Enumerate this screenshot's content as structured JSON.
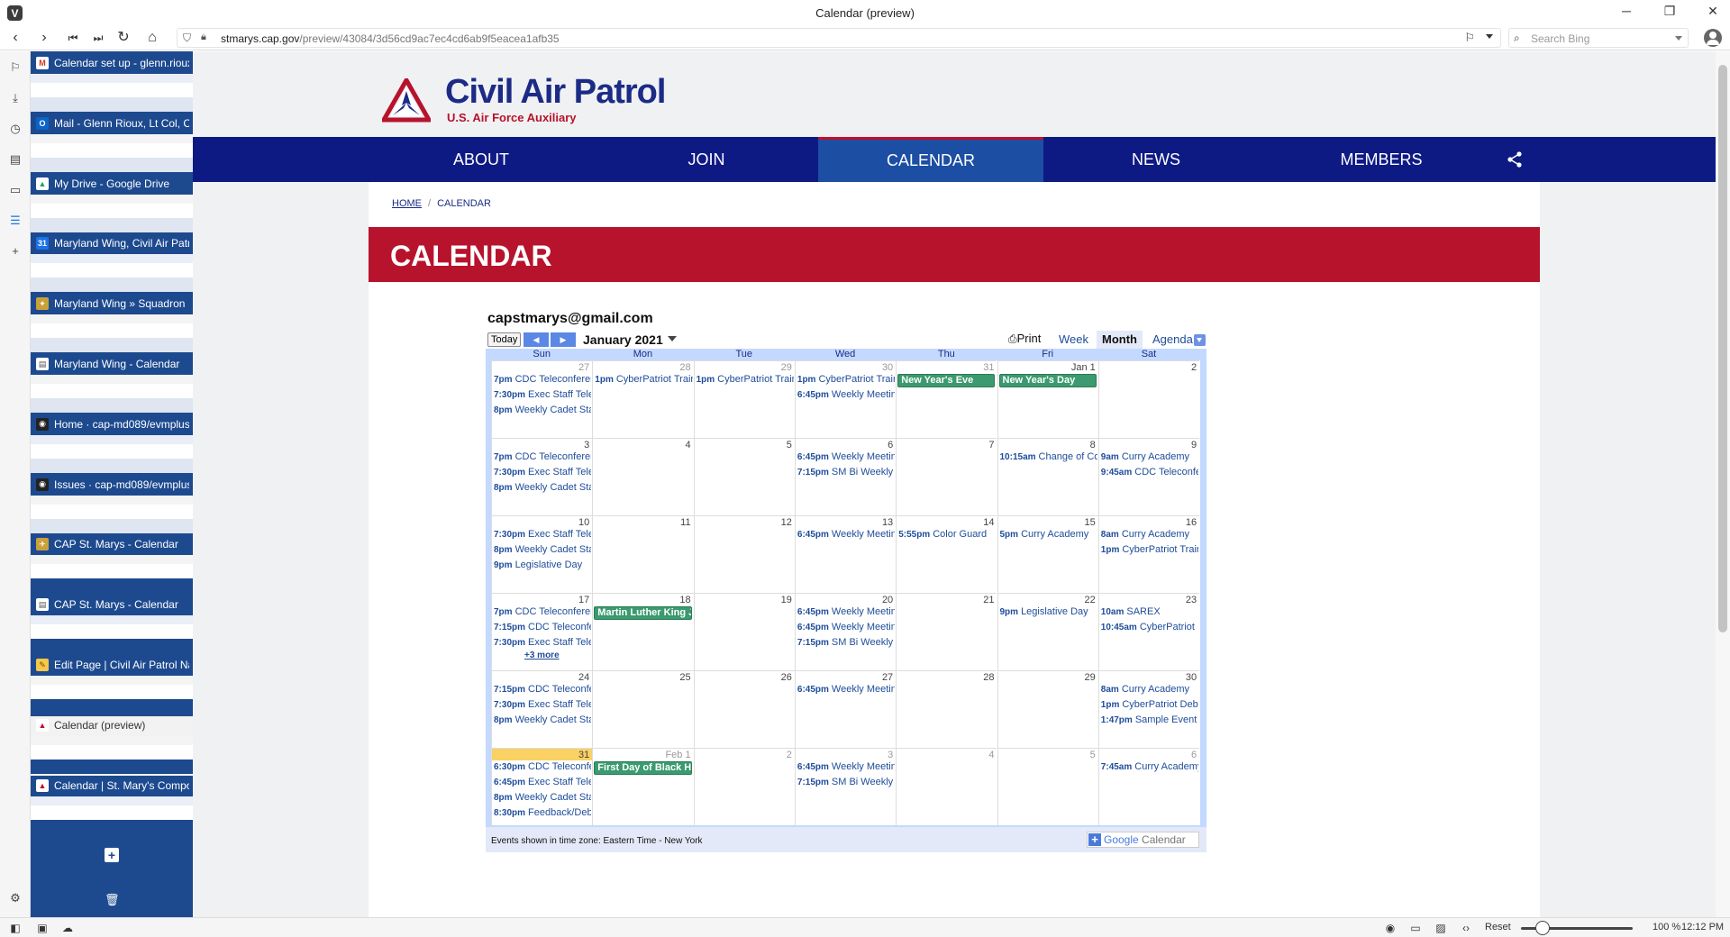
{
  "window": {
    "title": "Calendar (preview)",
    "minimize": "─",
    "restore": "❐",
    "close": "✕"
  },
  "toolbar": {
    "url_host": "stmarys.cap.gov",
    "url_path": "/preview/43084/3d56cd9ac7ec4cd6ab9f5eacea1afb35",
    "search_placeholder": "Search Bing"
  },
  "tabs": [
    {
      "title": "Calendar set up - glenn.rioux",
      "icon_color": "#ffffff",
      "icon_char": "M",
      "icon_fg": "#d93025"
    },
    {
      "title": "Mail - Glenn Rioux, Lt Col, CAP",
      "icon_color": "#0a64c9",
      "icon_char": "O",
      "icon_fg": "#ffffff"
    },
    {
      "title": "My Drive - Google Drive",
      "icon_color": "#ffffff",
      "icon_char": "▲",
      "icon_fg": "#1da462"
    },
    {
      "title": "Maryland Wing, Civil Air Patrol",
      "icon_color": "#1a73e8",
      "icon_char": "31",
      "icon_fg": "#ffffff"
    },
    {
      "title": "Maryland Wing » Squadron",
      "icon_color": "#c9a13a",
      "icon_char": "✦",
      "icon_fg": "#ffffff"
    },
    {
      "title": "Maryland Wing - Calendar",
      "icon_color": "#ffffff",
      "icon_char": "▤",
      "icon_fg": "#555555"
    },
    {
      "title": "Home · cap-md089/evmplus",
      "icon_color": "#222222",
      "icon_char": "◉",
      "icon_fg": "#ffffff"
    },
    {
      "title": "Issues · cap-md089/evmplus",
      "icon_color": "#222222",
      "icon_char": "◉",
      "icon_fg": "#ffffff"
    },
    {
      "title": "CAP St. Marys - Calendar",
      "icon_color": "#c9a13a",
      "icon_char": "✈",
      "icon_fg": "#ffffff"
    },
    {
      "title": "CAP St. Marys - Calendar",
      "icon_color": "#ffffff",
      "icon_char": "▤",
      "icon_fg": "#555555"
    },
    {
      "title": "Edit Page | Civil Air Patrol National",
      "icon_color": "#f4c84a",
      "icon_char": "✎",
      "icon_fg": "#7a4a00"
    },
    {
      "title": "Calendar (preview)",
      "icon_color": "#ffffff",
      "icon_char": "▲",
      "icon_fg": "#c0102a",
      "active": true
    },
    {
      "title": "Calendar | St. Mary's Composite",
      "icon_color": "#ffffff",
      "icon_char": "▲",
      "icon_fg": "#c0102a"
    }
  ],
  "site": {
    "name": "Civil Air Patrol",
    "subtitle": "U.S. Air Force Auxiliary",
    "nav": [
      "ABOUT",
      "JOIN",
      "CALENDAR",
      "NEWS",
      "MEMBERS"
    ],
    "active_nav": "CALENDAR",
    "breadcrumb_home": "HOME",
    "breadcrumb_current": "CALENDAR",
    "page_heading": "CALENDAR"
  },
  "calendar": {
    "owner": "capstmarys@gmail.com",
    "today_label": "Today",
    "prev": "◀",
    "next": "▶",
    "month_label": "January 2021",
    "print_label": "Print",
    "views": [
      "Week",
      "Month",
      "Agenda"
    ],
    "active_view": "Month",
    "days_of_week": [
      "Sun",
      "Mon",
      "Tue",
      "Wed",
      "Thu",
      "Fri",
      "Sat"
    ],
    "timezone_note": "Events shown in time zone: Eastern Time - New York",
    "gcal_brand": "Google",
    "gcal_label": "Calendar",
    "weeks": [
      [
        {
          "day": "27",
          "other": true,
          "events": [
            {
              "t": "7pm",
              "n": "CDC Teleconference"
            },
            {
              "t": "7:30pm",
              "n": "Exec Staff Teleconference"
            },
            {
              "t": "8pm",
              "n": "Weekly Cadet Staff"
            }
          ]
        },
        {
          "day": "28",
          "other": true,
          "events": [
            {
              "t": "1pm",
              "n": "CyberPatriot Training"
            }
          ]
        },
        {
          "day": "29",
          "other": true,
          "events": [
            {
              "t": "1pm",
              "n": "CyberPatriot Training"
            }
          ]
        },
        {
          "day": "30",
          "other": true,
          "events": [
            {
              "t": "1pm",
              "n": "CyberPatriot Training"
            },
            {
              "t": "6:45pm",
              "n": "Weekly Meeting"
            }
          ]
        },
        {
          "day": "31",
          "other": true,
          "allday": "New Year's Eve",
          "events": []
        },
        {
          "day": "Jan 1",
          "other": false,
          "allday": "New Year's Day",
          "events": []
        },
        {
          "day": "2",
          "other": false,
          "events": []
        }
      ],
      [
        {
          "day": "3",
          "events": [
            {
              "t": "7pm",
              "n": "CDC Teleconference"
            },
            {
              "t": "7:30pm",
              "n": "Exec Staff Teleconference"
            },
            {
              "t": "8pm",
              "n": "Weekly Cadet Staff"
            }
          ]
        },
        {
          "day": "4",
          "events": []
        },
        {
          "day": "5",
          "events": []
        },
        {
          "day": "6",
          "events": [
            {
              "t": "6:45pm",
              "n": "Weekly Meeting"
            },
            {
              "t": "7:15pm",
              "n": "SM Bi Weekly"
            }
          ]
        },
        {
          "day": "7",
          "events": []
        },
        {
          "day": "8",
          "events": [
            {
              "t": "10:15am",
              "n": "Change of Command"
            }
          ]
        },
        {
          "day": "9",
          "events": [
            {
              "t": "9am",
              "n": "Curry Academy"
            },
            {
              "t": "9:45am",
              "n": "CDC Teleconference"
            }
          ]
        }
      ],
      [
        {
          "day": "10",
          "events": [
            {
              "t": "7:30pm",
              "n": "Exec Staff Teleconference"
            },
            {
              "t": "8pm",
              "n": "Weekly Cadet Staff"
            },
            {
              "t": "9pm",
              "n": "Legislative Day"
            }
          ]
        },
        {
          "day": "11",
          "events": []
        },
        {
          "day": "12",
          "events": []
        },
        {
          "day": "13",
          "events": [
            {
              "t": "6:45pm",
              "n": "Weekly Meeting"
            }
          ]
        },
        {
          "day": "14",
          "events": [
            {
              "t": "5:55pm",
              "n": "Color Guard"
            }
          ]
        },
        {
          "day": "15",
          "events": [
            {
              "t": "5pm",
              "n": "Curry Academy"
            }
          ]
        },
        {
          "day": "16",
          "events": [
            {
              "t": "8am",
              "n": "Curry Academy"
            },
            {
              "t": "1pm",
              "n": "CyberPatriot Training"
            }
          ]
        }
      ],
      [
        {
          "day": "17",
          "events": [
            {
              "t": "7pm",
              "n": "CDC Teleconference"
            },
            {
              "t": "7:15pm",
              "n": "CDC Teleconference"
            },
            {
              "t": "7:30pm",
              "n": "Exec Staff Teleconference"
            }
          ],
          "more": "+3 more"
        },
        {
          "day": "18",
          "allday": "Martin Luther King Jr. Day",
          "events": []
        },
        {
          "day": "19",
          "events": []
        },
        {
          "day": "20",
          "events": [
            {
              "t": "6:45pm",
              "n": "Weekly Meeting"
            },
            {
              "t": "6:45pm",
              "n": "Weekly Meeting"
            },
            {
              "t": "7:15pm",
              "n": "SM Bi Weekly"
            }
          ]
        },
        {
          "day": "21",
          "events": []
        },
        {
          "day": "22",
          "events": [
            {
              "t": "9pm",
              "n": "Legislative Day"
            }
          ]
        },
        {
          "day": "23",
          "events": [
            {
              "t": "10am",
              "n": "SAREX"
            },
            {
              "t": "10:45am",
              "n": "CyberPatriot"
            }
          ]
        }
      ],
      [
        {
          "day": "24",
          "events": [
            {
              "t": "7:15pm",
              "n": "CDC Teleconference"
            },
            {
              "t": "7:30pm",
              "n": "Exec Staff Teleconference"
            },
            {
              "t": "8pm",
              "n": "Weekly Cadet Staff"
            }
          ]
        },
        {
          "day": "25",
          "events": []
        },
        {
          "day": "26",
          "events": []
        },
        {
          "day": "27",
          "events": [
            {
              "t": "6:45pm",
              "n": "Weekly Meeting"
            }
          ]
        },
        {
          "day": "28",
          "events": []
        },
        {
          "day": "29",
          "events": []
        },
        {
          "day": "30",
          "events": [
            {
              "t": "8am",
              "n": "Curry Academy"
            },
            {
              "t": "1pm",
              "n": "CyberPatriot Debrief"
            },
            {
              "t": "1:47pm",
              "n": "Sample Event"
            }
          ]
        }
      ],
      [
        {
          "day": "31",
          "today": true,
          "events": [
            {
              "t": "6:30pm",
              "n": "CDC Teleconference"
            },
            {
              "t": "6:45pm",
              "n": "Exec Staff Teleconference"
            },
            {
              "t": "8pm",
              "n": "Weekly Cadet Staff"
            },
            {
              "t": "8:30pm",
              "n": "Feedback/Debrief"
            }
          ]
        },
        {
          "day": "Feb 1",
          "other": true,
          "allday": "First Day of Black History Month",
          "events": []
        },
        {
          "day": "2",
          "other": true,
          "events": []
        },
        {
          "day": "3",
          "other": true,
          "events": [
            {
              "t": "6:45pm",
              "n": "Weekly Meeting"
            },
            {
              "t": "7:15pm",
              "n": "SM Bi Weekly"
            }
          ]
        },
        {
          "day": "4",
          "other": true,
          "events": []
        },
        {
          "day": "5",
          "other": true,
          "events": []
        },
        {
          "day": "6",
          "other": true,
          "events": [
            {
              "t": "7:45am",
              "n": "Curry Academy"
            }
          ]
        }
      ]
    ]
  },
  "status": {
    "reset": "Reset",
    "zoom": "100 %",
    "clock": "12:12 PM"
  },
  "colors": {
    "nav_bg": "#0e1a84",
    "nav_active": "#1c4ea3",
    "heading_red": "#b7132c",
    "brand_blue": "#1b2b86",
    "tab_panel": "#1d4a8f",
    "allday_green": "#3b9a6f",
    "today_yellow": "#fad163"
  }
}
